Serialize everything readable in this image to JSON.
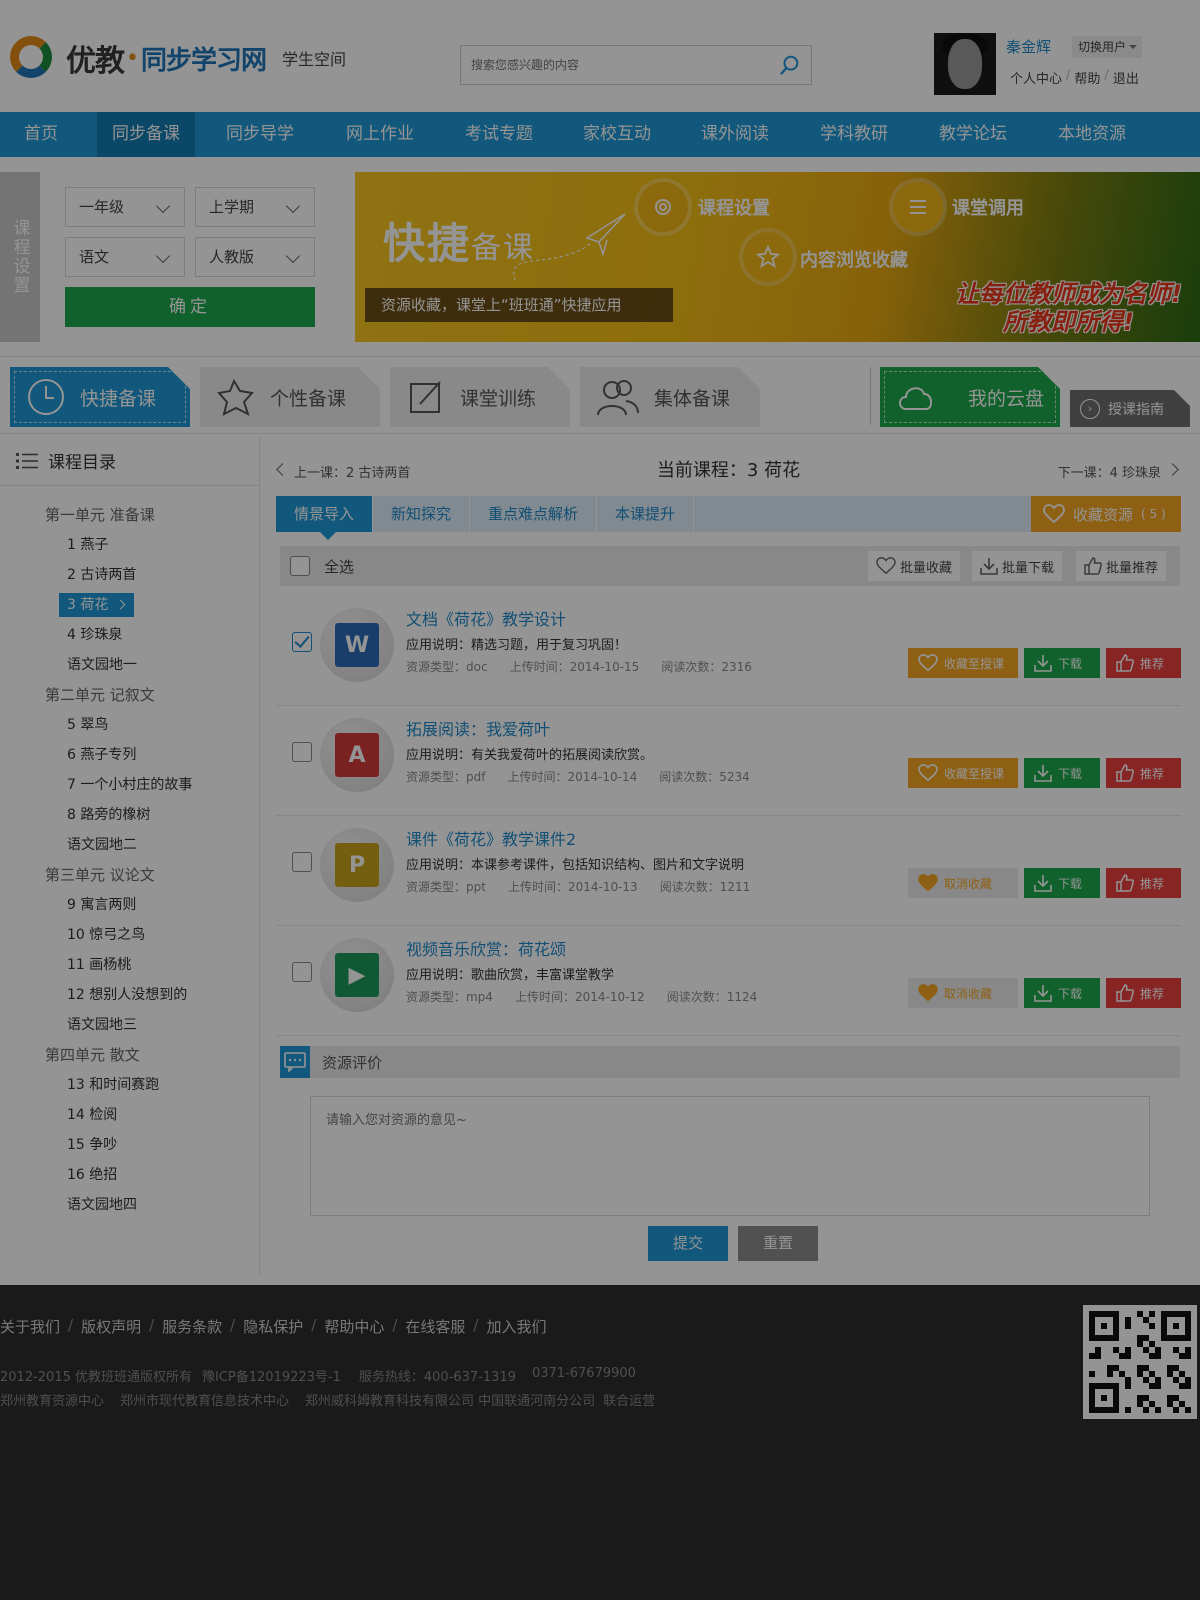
{
  "header": {
    "logo_brand": "优教",
    "logo_product": "同步学习网",
    "logo_sub": "学生空间",
    "search_placeholder": "搜索您感兴趣的内容",
    "user_name": "秦金辉",
    "switch_user": "切换用户",
    "links": [
      "个人中心",
      "帮助",
      "退出"
    ]
  },
  "nav": {
    "items": [
      "首页",
      "同步备课",
      "同步导学",
      "网上作业",
      "考试专题",
      "家校互动",
      "课外阅读",
      "学科教研",
      "教学论坛",
      "本地资源"
    ],
    "active_index": 1
  },
  "settings": {
    "tab_label": "课程设置",
    "grade": "一年级",
    "term": "上学期",
    "subject": "语文",
    "edition": "人教版",
    "confirm": "确定"
  },
  "banner": {
    "title_big": "快捷",
    "title_small": "备课",
    "note": "资源收藏，课堂上“班班通”快捷应用",
    "feature_1": "课程设置",
    "feature_2": "内容浏览收藏",
    "feature_3": "课堂调用",
    "slogan_1": "让每位教师成为名师!",
    "slogan_2": "所教即所得!"
  },
  "prep_tabs": [
    "快捷备课",
    "个性备课",
    "课堂训练",
    "集体备课"
  ],
  "cloud_tab": "我的云盘",
  "guide": "授课指南",
  "sidebar": {
    "title": "课程目录",
    "entries": [
      {
        "type": "unit",
        "label": "第一单元 准备课"
      },
      {
        "type": "lesson",
        "label": "1 燕子"
      },
      {
        "type": "lesson",
        "label": "2 古诗两首"
      },
      {
        "type": "lesson",
        "label": "3 荷花",
        "active": true
      },
      {
        "type": "lesson",
        "label": "4 珍珠泉"
      },
      {
        "type": "lesson",
        "label": "语文园地一"
      },
      {
        "type": "unit",
        "label": "第二单元 记叙文"
      },
      {
        "type": "lesson",
        "label": "5 翠鸟"
      },
      {
        "type": "lesson",
        "label": "6 燕子专列"
      },
      {
        "type": "lesson",
        "label": "7 一个小村庄的故事"
      },
      {
        "type": "lesson",
        "label": "8 路旁的橡树"
      },
      {
        "type": "lesson",
        "label": "语文园地二"
      },
      {
        "type": "unit",
        "label": "第三单元 议论文"
      },
      {
        "type": "lesson",
        "label": "9 寓言两则"
      },
      {
        "type": "lesson",
        "label": "10 惊弓之鸟"
      },
      {
        "type": "lesson",
        "label": "11 画杨桃"
      },
      {
        "type": "lesson",
        "label": "12 想别人没想到的"
      },
      {
        "type": "lesson",
        "label": "语文园地三"
      },
      {
        "type": "unit",
        "label": "第四单元 散文"
      },
      {
        "type": "lesson",
        "label": "13 和时间赛跑"
      },
      {
        "type": "lesson",
        "label": "14 检阅"
      },
      {
        "type": "lesson",
        "label": "15 争吵"
      },
      {
        "type": "lesson",
        "label": "16 绝招"
      },
      {
        "type": "lesson",
        "label": "语文园地四"
      }
    ]
  },
  "lesson_nav": {
    "prev": "上一课：2 古诗两首",
    "current": "当前课程：3 荷花",
    "next": "下一课：4 珍珠泉"
  },
  "subtabs": [
    "情景导入",
    "新知探究",
    "重点难点解析",
    "本课提升"
  ],
  "fav_resources": {
    "label": "收藏资源",
    "count": "( 5 )"
  },
  "toolbar": {
    "select_all": "全选",
    "batch_fav": "批量收藏",
    "batch_download": "批量下载",
    "batch_recommend": "批量推荐"
  },
  "resources": [
    {
      "title": "文档《荷花》教学设计",
      "desc": "应用说明：精选习题，用于复习巩固！",
      "type": "资源类型：doc",
      "time": "上传时间：2014-10-15",
      "reads": "阅读次数：2316",
      "fav": "收藏至授课",
      "favored": false,
      "checked": true,
      "icon": "W",
      "color": "#2b6cb8"
    },
    {
      "title": "拓展阅读：我爱荷叶",
      "desc": "应用说明：有关我爱荷叶的拓展阅读欣赏。",
      "type": "资源类型：pdf",
      "time": "上传时间：2014-10-14",
      "reads": "阅读次数：5234",
      "fav": "收藏至授课",
      "favored": false,
      "checked": false,
      "icon": "A",
      "color": "#d33a3a"
    },
    {
      "title": "课件《荷花》教学课件2",
      "desc": "应用说明：本课参考课件，包括知识结构、图片和文字说明",
      "type": "资源类型：ppt",
      "time": "上传时间：2014-10-13",
      "reads": "阅读次数：1211",
      "fav": "取消收藏",
      "favored": true,
      "checked": false,
      "icon": "P",
      "color": "#c9a21a"
    },
    {
      "title": "视频音乐欣赏：荷花颂",
      "desc": "应用说明：歌曲欣赏，丰富课堂教学",
      "type": "资源类型：mp4",
      "time": "上传时间：2014-10-12",
      "reads": "阅读次数：1124",
      "fav": "取消收藏",
      "favored": true,
      "checked": false,
      "icon": "▶",
      "color": "#1e9a5a"
    }
  ],
  "actions": {
    "download": "下载",
    "recommend": "推荐"
  },
  "evaluation": {
    "title": "资源评价",
    "placeholder": "请输入您对资源的意见~",
    "submit": "提交",
    "reset": "重置"
  },
  "footer": {
    "links": [
      "关于我们",
      "版权声明",
      "服务条款",
      "隐私保护",
      "帮助中心",
      "在线客服",
      "加入我们"
    ],
    "copyright": "2012-2015 优教班班通版权所有",
    "icp": "豫ICP备12019223号-1",
    "hotline": "服务热线：400-637-1319",
    "phone": "0371-67679900",
    "partners": [
      "郑州教育资源中心",
      "郑州市现代教育信息技术中心",
      "郑州威科姆教育科技有限公司 中国联通河南分公司",
      "联合运营"
    ]
  },
  "colors": {
    "primary": "#1f98d6",
    "green": "#1ea84c",
    "orange": "#f5a623",
    "red": "#e94141"
  }
}
